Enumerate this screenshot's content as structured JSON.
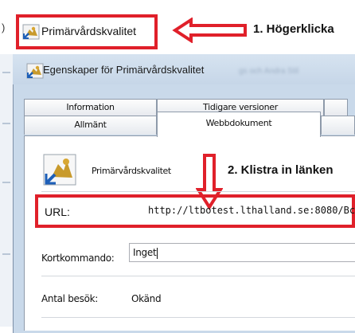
{
  "top": {
    "edge_char": ")",
    "shortcut_name": "Primärvårdskvalitet",
    "callout": "1. Högerklicka"
  },
  "window": {
    "title": "Egenskaper för Primärvårdskvalitet",
    "blurred_text": "gs och Andra Stil"
  },
  "tabs": {
    "information": "Information",
    "previous_versions": "Tidigare versioner",
    "general": "Allmänt",
    "web_document": "Webbdokument"
  },
  "panel": {
    "file_name": "Primärvårdskvalitet",
    "callout": "2. Klistra in länken",
    "url_label": "URL:",
    "url_value": "http://ltbotest.lthalland.se:8080/Bc",
    "shortcut_label": "Kortkommando:",
    "shortcut_value": "Inget",
    "visits_label": "Antal besök:",
    "visits_value": "Okänd"
  },
  "colors": {
    "highlight_red": "#e0202a",
    "window_blue": "#c9d9ea"
  },
  "icons": {
    "app_icon": "web-shortcut-icon",
    "arrow_left": "arrow-left-icon",
    "arrow_down": "arrow-down-icon"
  }
}
